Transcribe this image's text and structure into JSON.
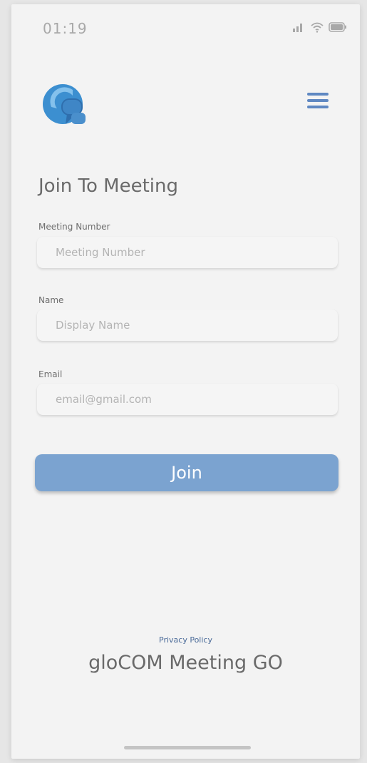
{
  "status_bar": {
    "time": "01:19",
    "icons": [
      "signal-icon",
      "wifi-icon",
      "battery-icon"
    ]
  },
  "header": {
    "logo": "glocom-logo",
    "menu_icon": "hamburger-menu-icon"
  },
  "form": {
    "title": "Join To Meeting",
    "meeting_number": {
      "label": "Meeting Number",
      "placeholder": "Meeting Number",
      "value": ""
    },
    "name": {
      "label": "Name",
      "placeholder": "Display Name",
      "value": ""
    },
    "email": {
      "label": "Email",
      "placeholder": "email@gmail.com",
      "value": ""
    },
    "join_label": "Join"
  },
  "footer": {
    "privacy_label": "Privacy Policy",
    "brand": "gloCOM Meeting GO"
  },
  "colors": {
    "accent": "#7ba3d0",
    "menu_icon": "#5f88c2",
    "background": "#f3f3f3"
  }
}
